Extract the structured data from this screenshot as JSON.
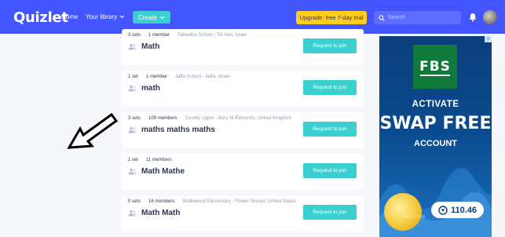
{
  "header": {
    "logo": "Quizlet",
    "nav_home": "Home",
    "nav_library": "Your library",
    "create": "Create",
    "upgrade": "Upgrade: free 7-day trial",
    "search_placeholder": "Search",
    "brand_color": "#4255ff"
  },
  "results": [
    {
      "sets": "3 sets",
      "members": "1 member",
      "school": "Tabeetha School - Tel Aviv, Israel",
      "name": "Math",
      "button": "Request to join"
    },
    {
      "sets": "1 set",
      "members": "1 member",
      "school": "Jaffa School - Jaffa, Israel",
      "name": "math",
      "button": "Request to join"
    },
    {
      "sets": "3 sets",
      "members": "109 members",
      "school": "County Upper - Bury St Edmunds, United Kingdom",
      "name": "maths maths maths",
      "button": "Request to join"
    },
    {
      "sets": "1 set",
      "members": "11 members",
      "school": "",
      "name": "Math Mathe",
      "button": "Request to join"
    },
    {
      "sets": "0 sets",
      "members": "16 members",
      "school": "Bridlewood Elementary - Flower Mound, United States",
      "name": "Math Math",
      "button": "Request to join"
    }
  ],
  "ad": {
    "logo": "FBS",
    "line1": "ACTIVATE",
    "line2": "SWAP FREE",
    "line3": "ACCOUNT",
    "price": "110.46",
    "badge": "x",
    "watermark": "Activate"
  }
}
